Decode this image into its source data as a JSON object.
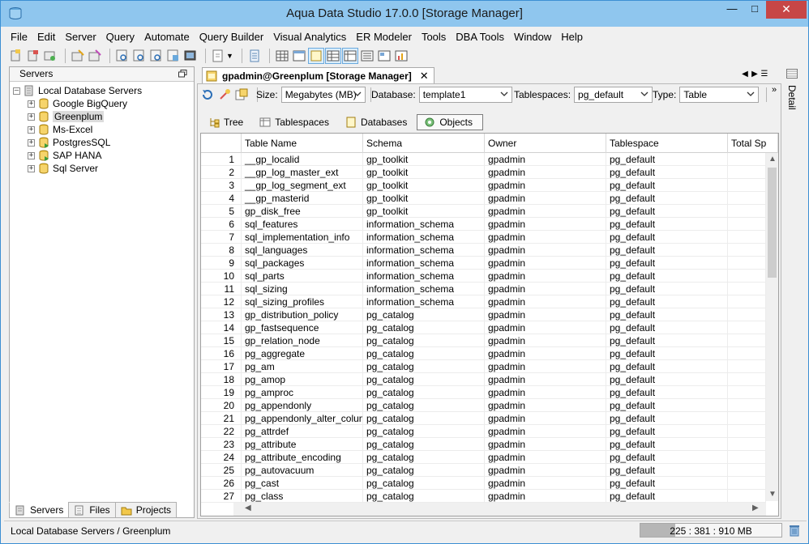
{
  "window": {
    "title": "Aqua Data Studio 17.0.0 [Storage Manager]"
  },
  "menu": [
    "File",
    "Edit",
    "Server",
    "Query",
    "Automate",
    "Query Builder",
    "Visual Analytics",
    "ER Modeler",
    "Tools",
    "DBA Tools",
    "Window",
    "Help"
  ],
  "servers_panel": {
    "title": "Servers",
    "root": "Local Database Servers",
    "items": [
      "Google BigQuery",
      "Greenplum",
      "Ms-Excel",
      "PostgresSQL",
      "SAP HANA",
      "Sql Server"
    ],
    "selected": "Greenplum"
  },
  "bottom_tabs": [
    "Servers",
    "Files",
    "Projects"
  ],
  "editor": {
    "tab_title": "gpadmin@Greenplum [Storage Manager]",
    "size_label": "Size:",
    "size_value": "Megabytes (MB)",
    "database_label": "Database:",
    "database_value": "template1",
    "tablespaces_label": "Tablespaces:",
    "tablespaces_value": "pg_default",
    "type_label": "Type:",
    "type_value": "Table",
    "subtabs": [
      "Tree",
      "Tablespaces",
      "Databases",
      "Objects"
    ],
    "active_subtab": "Objects"
  },
  "table": {
    "columns": [
      "Table Name",
      "Schema",
      "Owner",
      "Tablespace",
      "Total Sp"
    ],
    "rows": [
      [
        "1",
        "__gp_localid",
        "gp_toolkit",
        "gpadmin",
        "pg_default"
      ],
      [
        "2",
        "__gp_log_master_ext",
        "gp_toolkit",
        "gpadmin",
        "pg_default"
      ],
      [
        "3",
        "__gp_log_segment_ext",
        "gp_toolkit",
        "gpadmin",
        "pg_default"
      ],
      [
        "4",
        "__gp_masterid",
        "gp_toolkit",
        "gpadmin",
        "pg_default"
      ],
      [
        "5",
        "gp_disk_free",
        "gp_toolkit",
        "gpadmin",
        "pg_default"
      ],
      [
        "6",
        "sql_features",
        "information_schema",
        "gpadmin",
        "pg_default"
      ],
      [
        "7",
        "sql_implementation_info",
        "information_schema",
        "gpadmin",
        "pg_default"
      ],
      [
        "8",
        "sql_languages",
        "information_schema",
        "gpadmin",
        "pg_default"
      ],
      [
        "9",
        "sql_packages",
        "information_schema",
        "gpadmin",
        "pg_default"
      ],
      [
        "10",
        "sql_parts",
        "information_schema",
        "gpadmin",
        "pg_default"
      ],
      [
        "11",
        "sql_sizing",
        "information_schema",
        "gpadmin",
        "pg_default"
      ],
      [
        "12",
        "sql_sizing_profiles",
        "information_schema",
        "gpadmin",
        "pg_default"
      ],
      [
        "13",
        "gp_distribution_policy",
        "pg_catalog",
        "gpadmin",
        "pg_default"
      ],
      [
        "14",
        "gp_fastsequence",
        "pg_catalog",
        "gpadmin",
        "pg_default"
      ],
      [
        "15",
        "gp_relation_node",
        "pg_catalog",
        "gpadmin",
        "pg_default"
      ],
      [
        "16",
        "pg_aggregate",
        "pg_catalog",
        "gpadmin",
        "pg_default"
      ],
      [
        "17",
        "pg_am",
        "pg_catalog",
        "gpadmin",
        "pg_default"
      ],
      [
        "18",
        "pg_amop",
        "pg_catalog",
        "gpadmin",
        "pg_default"
      ],
      [
        "19",
        "pg_amproc",
        "pg_catalog",
        "gpadmin",
        "pg_default"
      ],
      [
        "20",
        "pg_appendonly",
        "pg_catalog",
        "gpadmin",
        "pg_default"
      ],
      [
        "21",
        "pg_appendonly_alter_column",
        "pg_catalog",
        "gpadmin",
        "pg_default"
      ],
      [
        "22",
        "pg_attrdef",
        "pg_catalog",
        "gpadmin",
        "pg_default"
      ],
      [
        "23",
        "pg_attribute",
        "pg_catalog",
        "gpadmin",
        "pg_default"
      ],
      [
        "24",
        "pg_attribute_encoding",
        "pg_catalog",
        "gpadmin",
        "pg_default"
      ],
      [
        "25",
        "pg_autovacuum",
        "pg_catalog",
        "gpadmin",
        "pg_default"
      ],
      [
        "26",
        "pg_cast",
        "pg_catalog",
        "gpadmin",
        "pg_default"
      ],
      [
        "27",
        "pg_class",
        "pg_catalog",
        "gpadmin",
        "pg_default"
      ]
    ]
  },
  "right_panel": {
    "label": "Detail"
  },
  "status": {
    "path": "Local Database Servers / Greenplum",
    "memory": "225 : 381 : 910 MB",
    "memory_fraction": 0.247
  }
}
